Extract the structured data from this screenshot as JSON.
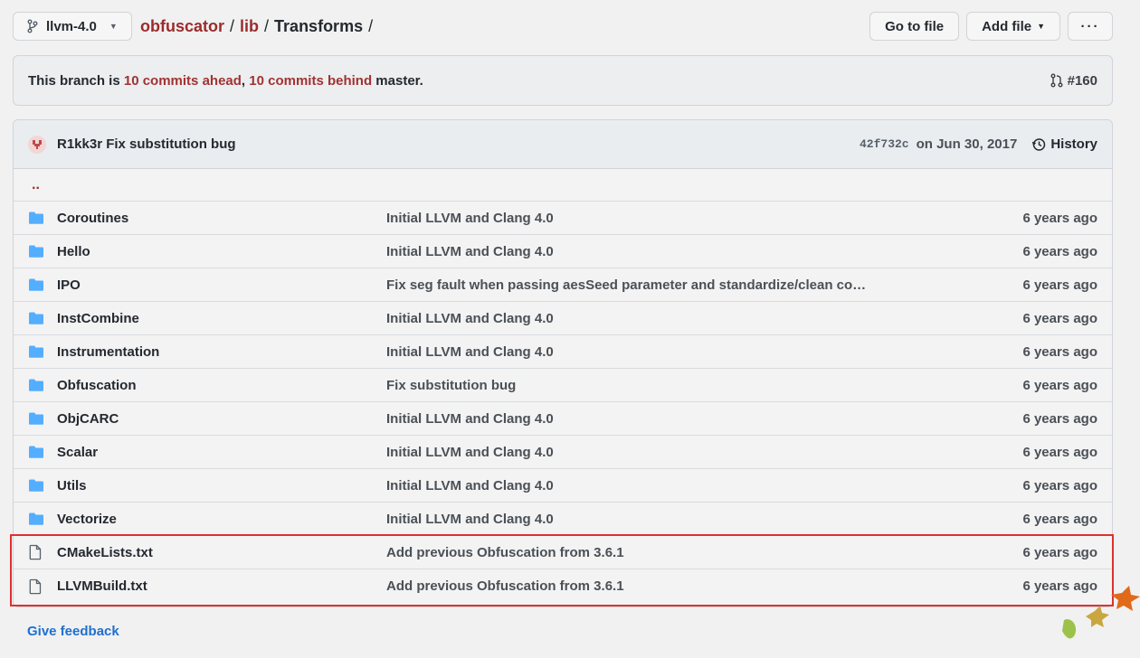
{
  "topbar": {
    "branch": "llvm-4.0",
    "breadcrumb": [
      {
        "label": "obfuscator",
        "link": true
      },
      {
        "label": "lib",
        "link": true
      },
      {
        "label": "Transforms",
        "link": false
      }
    ],
    "sep": "/",
    "go_to_file": "Go to file",
    "add_file": "Add file",
    "more": "···"
  },
  "branch_status": {
    "prefix": "This branch is ",
    "ahead": "10 commits ahead",
    "comma": ", ",
    "behind": "10 commits behind",
    "suffix": " master.",
    "pr": "#160"
  },
  "latest_commit": {
    "message": "R1kk3r Fix substitution bug",
    "sha": "42f732c",
    "date": "on Jun 30, 2017",
    "history": "History"
  },
  "parent_dir": "..",
  "files": [
    {
      "type": "dir",
      "name": "Coroutines",
      "message": "Initial LLVM and Clang 4.0",
      "age": "6 years ago"
    },
    {
      "type": "dir",
      "name": "Hello",
      "message": "Initial LLVM and Clang 4.0",
      "age": "6 years ago"
    },
    {
      "type": "dir",
      "name": "IPO",
      "message": "Fix seg fault when passing aesSeed parameter and standardize/clean co…",
      "age": "6 years ago"
    },
    {
      "type": "dir",
      "name": "InstCombine",
      "message": "Initial LLVM and Clang 4.0",
      "age": "6 years ago"
    },
    {
      "type": "dir",
      "name": "Instrumentation",
      "message": "Initial LLVM and Clang 4.0",
      "age": "6 years ago"
    },
    {
      "type": "dir",
      "name": "Obfuscation",
      "message": "Fix substitution bug",
      "age": "6 years ago"
    },
    {
      "type": "dir",
      "name": "ObjCARC",
      "message": "Initial LLVM and Clang 4.0",
      "age": "6 years ago"
    },
    {
      "type": "dir",
      "name": "Scalar",
      "message": "Initial LLVM and Clang 4.0",
      "age": "6 years ago"
    },
    {
      "type": "dir",
      "name": "Utils",
      "message": "Initial LLVM and Clang 4.0",
      "age": "6 years ago"
    },
    {
      "type": "dir",
      "name": "Vectorize",
      "message": "Initial LLVM and Clang 4.0",
      "age": "6 years ago"
    },
    {
      "type": "file",
      "name": "CMakeLists.txt",
      "message": "Add previous Obfuscation from 3.6.1",
      "age": "6 years ago"
    },
    {
      "type": "file",
      "name": "LLVMBuild.txt",
      "message": "Add previous Obfuscation from 3.6.1",
      "age": "6 years ago"
    }
  ],
  "feedback": "Give feedback",
  "colors": {
    "folder": "#54aeff",
    "link_red": "#9b2c2c",
    "highlight": "#e03030",
    "feedback": "#1f6fd0"
  }
}
